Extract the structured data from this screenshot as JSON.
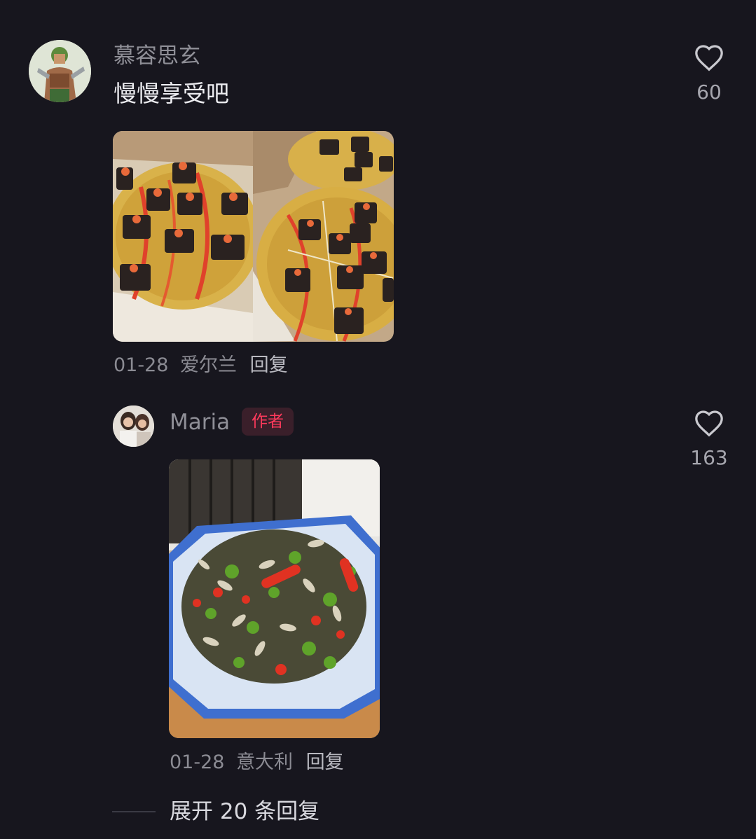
{
  "comment1": {
    "username": "慕容思玄",
    "text": "慢慢享受吧",
    "date": "01-28",
    "location": "爱尔兰",
    "reply_label": "回复",
    "likes": "60"
  },
  "comment2": {
    "username": "Maria",
    "badge": "作者",
    "date": "01-28",
    "location": "意大利",
    "reply_label": "回复",
    "likes": "163"
  },
  "expand_replies": "展开 20 条回复",
  "colors": {
    "background": "#17161e",
    "author_badge": "#ff3a5c"
  }
}
